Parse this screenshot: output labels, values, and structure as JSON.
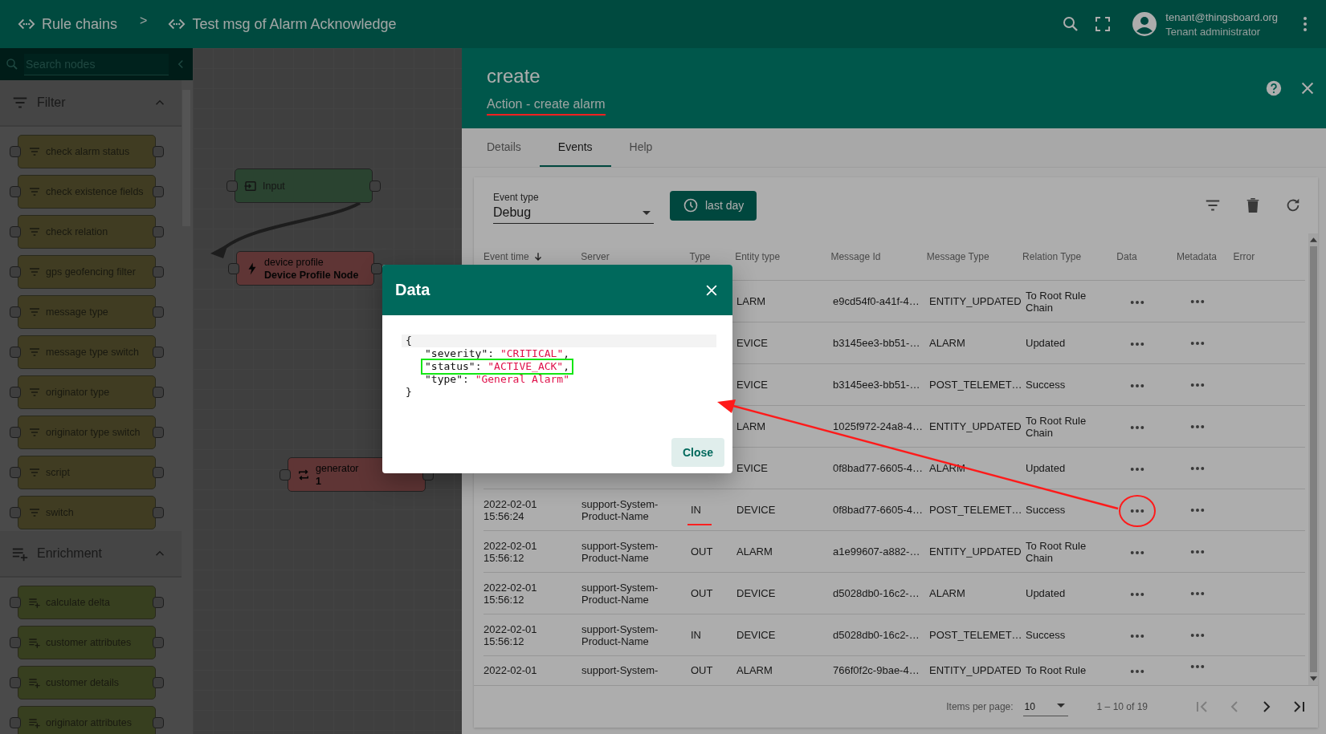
{
  "breadcrumbs": [
    {
      "label": "Rule chains"
    },
    {
      "label": "Test msg of Alarm Acknowledge"
    }
  ],
  "breadcrumb_separator": ">",
  "user": {
    "email": "tenant@thingsboard.org",
    "role": "Tenant administrator"
  },
  "node_library": {
    "search": {
      "placeholder": "Search nodes"
    },
    "sections": [
      {
        "kind": "filter",
        "title": "Filter",
        "expanded": true,
        "nodes": [
          "check alarm status",
          "check existence fields",
          "check relation",
          "gps geofencing filter",
          "message type",
          "message type switch",
          "originator type",
          "originator type switch",
          "script",
          "switch"
        ]
      },
      {
        "kind": "enrichment",
        "title": "Enrichment",
        "expanded": true,
        "nodes": [
          "calculate delta",
          "customer attributes",
          "customer details",
          "originator attributes"
        ]
      }
    ]
  },
  "canvas": {
    "nodes": [
      {
        "kind": "input",
        "name": "Input"
      },
      {
        "kind": "device_profile",
        "name": "device profile",
        "subtitle": "Device Profile Node"
      },
      {
        "kind": "generator",
        "name": "generator",
        "subtitle": "1"
      }
    ]
  },
  "details_panel": {
    "title": "create",
    "subtitle": "Action - create alarm",
    "subtitle_underlined": true,
    "tabs": [
      {
        "label": "Details",
        "selected": false
      },
      {
        "label": "Events",
        "selected": true
      },
      {
        "label": "Help",
        "selected": false
      }
    ],
    "event_type": {
      "label": "Event type",
      "value": "Debug"
    },
    "time_button": "last day",
    "table": {
      "columns": [
        {
          "label": "Event time",
          "sorted": true
        },
        {
          "label": "Server",
          "sorted": false
        },
        {
          "label": "Type",
          "sorted": false
        },
        {
          "label": "Entity type",
          "sorted": false
        },
        {
          "label": "Message Id",
          "sorted": false
        },
        {
          "label": "Message Type",
          "sorted": false
        },
        {
          "label": "Relation Type",
          "sorted": false
        },
        {
          "label": "Data",
          "sorted": false
        },
        {
          "label": "Metadata",
          "sorted": false
        },
        {
          "label": "Error",
          "sorted": false
        }
      ],
      "rows": [
        {
          "entity_type": "LARM",
          "message_id": "e9cd54f0-a41f-4…",
          "message_type": "ENTITY_UPDATED",
          "relation_type": "To Root Rule Chain",
          "type_underlined": false,
          "data_circled": false
        },
        {
          "entity_type": "EVICE",
          "message_id": "b3145ee3-bb51-…",
          "message_type": "ALARM",
          "relation_type": "Updated",
          "type_underlined": false,
          "data_circled": false
        },
        {
          "entity_type": "EVICE",
          "message_id": "b3145ee3-bb51-…",
          "message_type": "POST_TELEMET…",
          "relation_type": "Success",
          "type_underlined": false,
          "data_circled": false
        },
        {
          "entity_type": "LARM",
          "message_id": "1025f972-24a8-4…",
          "message_type": "ENTITY_UPDATED",
          "relation_type": "To Root Rule Chain",
          "type_underlined": false,
          "data_circled": false
        },
        {
          "entity_type": "EVICE",
          "message_id": "0f8bad77-6605-4…",
          "message_type": "ALARM",
          "relation_type": "Updated",
          "type_underlined": false,
          "data_circled": false
        },
        {
          "event_time": "2022-02-01 15:56:24",
          "server": "support-System-Product-Name",
          "type": "IN",
          "entity_type": "DEVICE",
          "message_id": "0f8bad77-6605-4…",
          "message_type": "POST_TELEMET…",
          "relation_type": "Success",
          "type_underlined": true,
          "data_circled": true
        },
        {
          "event_time": "2022-02-01 15:56:12",
          "server": "support-System-Product-Name",
          "type": "OUT",
          "entity_type": "ALARM",
          "message_id": "a1e99607-a882-…",
          "message_type": "ENTITY_UPDATED",
          "relation_type": "To Root Rule Chain",
          "type_underlined": false,
          "data_circled": false
        },
        {
          "event_time": "2022-02-01 15:56:12",
          "server": "support-System-Product-Name",
          "type": "OUT",
          "entity_type": "DEVICE",
          "message_id": "d5028db0-16c2-…",
          "message_type": "ALARM",
          "relation_type": "Updated",
          "type_underlined": false,
          "data_circled": false
        },
        {
          "event_time": "2022-02-01 15:56:12",
          "server": "support-System-Product-Name",
          "type": "IN",
          "entity_type": "DEVICE",
          "message_id": "d5028db0-16c2-…",
          "message_type": "POST_TELEMET…",
          "relation_type": "Success",
          "type_underlined": false,
          "data_circled": false
        },
        {
          "event_time": "2022-02-01",
          "server": "support-System-",
          "type": "OUT",
          "entity_type": "ALARM",
          "message_id": "766f0f2c-9bae-4…",
          "message_type": "ENTITY_UPDATED",
          "relation_type": "To Root Rule",
          "type_underlined": false,
          "data_circled": false
        }
      ]
    },
    "paginator": {
      "label": "Items per page:",
      "page_size": "10",
      "range": "1 – 10 of 19"
    }
  },
  "dialog": {
    "title": "Data",
    "close_button": "Close",
    "lines": [
      {
        "kind": "brace",
        "text": "{",
        "active": true,
        "highlighted": false
      },
      {
        "kind": "pair",
        "key": "\"severity\"",
        "colon": ": ",
        "value": "\"CRITICAL\"",
        "tail": ",",
        "active": false,
        "highlighted": false
      },
      {
        "kind": "pair",
        "key": "\"status\"",
        "colon": ": ",
        "value": "\"ACTIVE_ACK\"",
        "tail": ",",
        "active": false,
        "highlighted": true
      },
      {
        "kind": "pair",
        "key": "\"type\"",
        "colon": ": ",
        "value": "\"General Alarm\"",
        "active": false,
        "highlighted": false
      },
      {
        "kind": "brace",
        "text": "}",
        "active": false,
        "highlighted": false
      }
    ]
  },
  "annotations": [
    {
      "kind": "arrow"
    }
  ]
}
